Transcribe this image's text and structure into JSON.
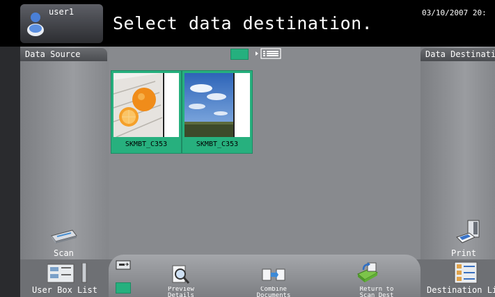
{
  "header": {
    "user_name": "user1",
    "title": "Select data destination.",
    "datetime": "03/10/2007 20:"
  },
  "left_panel": {
    "tab_label": "Data Source",
    "scan_label": "Scan"
  },
  "right_panel": {
    "tab_label": "Data Destinati",
    "print_label": "Print"
  },
  "thumbnails": [
    {
      "label": "SKMBT_C353",
      "image": "oranges-photo"
    },
    {
      "label": "SKMBT_C353",
      "image": "sky-landscape-photo"
    }
  ],
  "bottom": {
    "user_box_list_label": "User Box List",
    "preview_label": "Preview Details",
    "combine_label": "Combine Documents",
    "return_label": "Return to Scan Dest",
    "destination_list_label": "Destination Li"
  },
  "colors": {
    "accent": "#27b07e",
    "header_bg": "#000000"
  }
}
